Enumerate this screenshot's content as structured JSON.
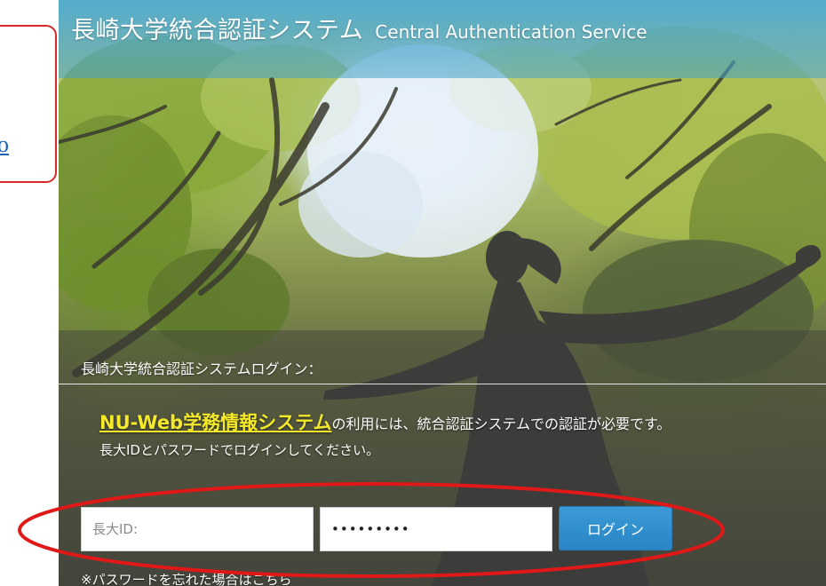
{
  "callout": {
    "link_text": "o"
  },
  "header": {
    "title_jp": "長崎大学統合認証システム",
    "title_en": "Central Authentication Service"
  },
  "login": {
    "heading": "長崎大学統合認証システムログイン：",
    "system_link": "NU-Web学務情報システム",
    "desc_rest": "の利用には、統合認証システムでの認証が必要です。",
    "desc_line2": "長大IDとパスワードでログインしてください。",
    "id_placeholder": "長大ID:",
    "password_value": "123456789",
    "login_button": "ログイン",
    "forgot_link": "※パスワードを忘れた場合はこちら"
  },
  "colors": {
    "annotation_red": "#e01818",
    "header_blue": "#4aa8d2",
    "button_blue": "#2a86c6",
    "link_yellow": "#f4ea2a"
  }
}
